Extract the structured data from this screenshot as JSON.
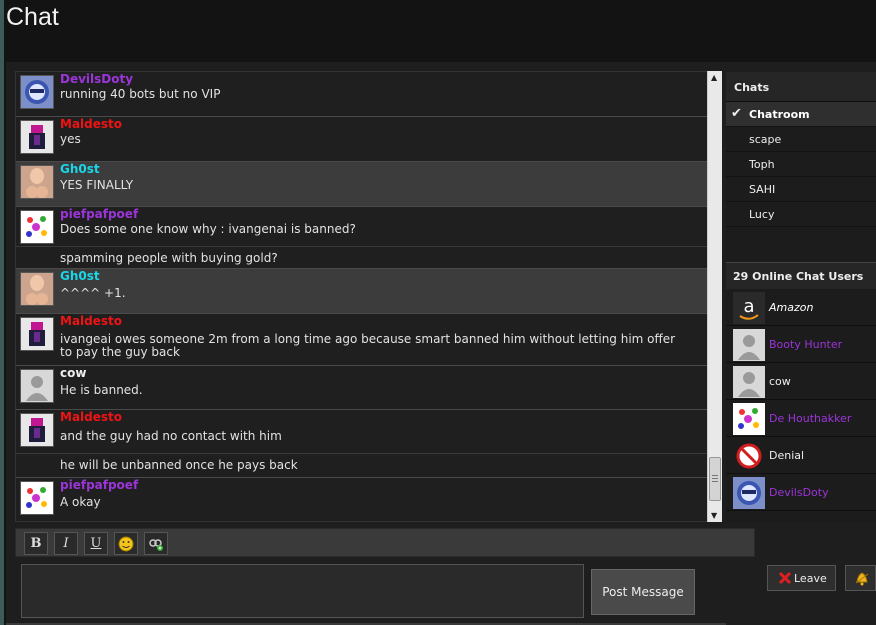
{
  "page": {
    "title": "Chat"
  },
  "colors": {
    "purple": "#9b35d8",
    "red": "#ee1414",
    "cyan": "#1ad6e8",
    "white": "#eeeeee"
  },
  "messages": [
    {
      "user": "DevilsDoty",
      "color": "#9b35d8",
      "text": "running 40 bots but no VIP",
      "avatar": "devilsdoty-avatar",
      "highlight": false
    },
    {
      "user": "Maldesto",
      "color": "#ee1414",
      "text": "yes",
      "avatar": "maldesto-avatar",
      "highlight": false
    },
    {
      "user": "Gh0st",
      "color": "#1ad6e8",
      "text": "YES FINALLY",
      "avatar": "gh0st-avatar",
      "highlight": true
    },
    {
      "user": "piefpafpoef",
      "color": "#9b35d8",
      "text": "Does some one know why : ivangenai is banned?",
      "avatar": "piefpafpoef-avatar",
      "highlight": false
    },
    {
      "user": "",
      "color": "",
      "text": "spamming people with buying gold?",
      "avatar": "",
      "highlight": false
    },
    {
      "user": "Gh0st",
      "color": "#1ad6e8",
      "text": "^^^^ +1.",
      "avatar": "gh0st-avatar",
      "highlight": true
    },
    {
      "user": "Maldesto",
      "color": "#ee1414",
      "text": "ivangeai owes someone 2m from a long time ago because smart banned him without letting him offer to pay the guy back",
      "avatar": "maldesto-avatar",
      "highlight": false
    },
    {
      "user": "cow",
      "color": "#eeeeee",
      "text": "He is banned.",
      "avatar": "default-avatar",
      "highlight": false
    },
    {
      "user": "Maldesto",
      "color": "#ee1414",
      "text": "and the guy had no contact with him",
      "avatar": "maldesto-avatar",
      "highlight": false
    },
    {
      "user": "",
      "color": "",
      "text": "he will be unbanned once he pays back",
      "avatar": "",
      "highlight": false
    },
    {
      "user": "piefpafpoef",
      "color": "#9b35d8",
      "text": "A okay",
      "avatar": "piefpafpoef-avatar",
      "highlight": false
    }
  ],
  "chats": {
    "header": "Chats",
    "items": [
      "Chatroom",
      "scape",
      "Toph",
      "SAHI",
      "Lucy"
    ],
    "active": "Chatroom"
  },
  "online": {
    "header": "29 Online Chat Users",
    "users": [
      {
        "name": "Amazon",
        "color": "#ffffff",
        "italic": true,
        "avatar": "amazon-avatar"
      },
      {
        "name": "Booty Hunter",
        "color": "#9b35d8",
        "italic": false,
        "avatar": "default-avatar"
      },
      {
        "name": "cow",
        "color": "#eeeeee",
        "italic": false,
        "avatar": "default-avatar"
      },
      {
        "name": "De Houthakker",
        "color": "#9b35d8",
        "italic": false,
        "avatar": "piefpafpoef-avatar"
      },
      {
        "name": "Denial",
        "color": "#eeeeee",
        "italic": false,
        "avatar": "no-symbol-avatar"
      },
      {
        "name": "DevilsDoty",
        "color": "#9b35d8",
        "italic": false,
        "avatar": "devilsdoty-avatar"
      }
    ]
  },
  "toolbar": {
    "bold": "B",
    "italic": "I",
    "underline": "U"
  },
  "composer": {
    "post_label": "Post Message"
  },
  "actions": {
    "leave_label": "Leave"
  }
}
